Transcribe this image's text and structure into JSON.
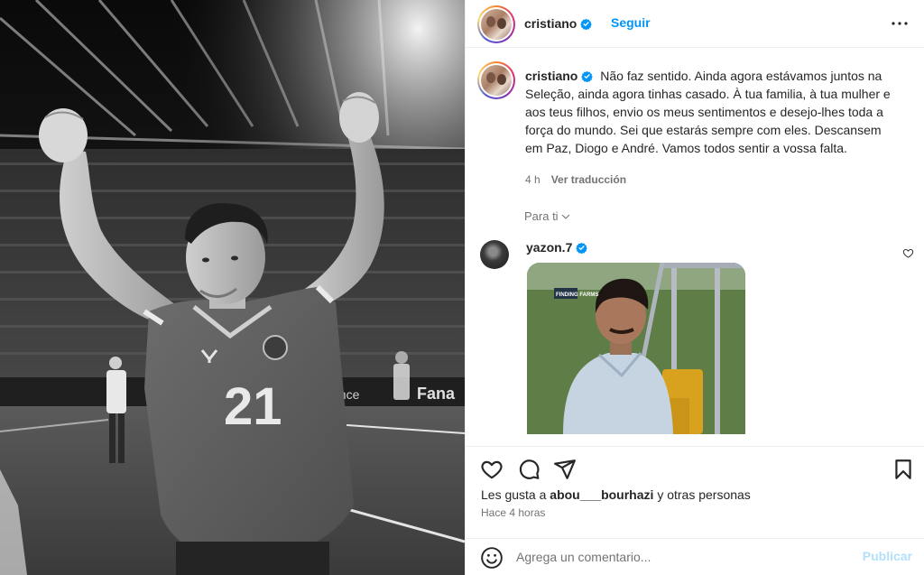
{
  "post": {
    "author": "cristiano",
    "follow_label": "Seguir",
    "caption_author": "cristiano",
    "caption": "Não faz sentido. Ainda agora estávamos juntos na Seleção, ainda agora tinhas casado. À tua familia, à tua mulher e aos teus filhos, envio os meus sentimentos e desejo-lhes toda a força do mundo. Sei que estarás sempre com eles. Descansem em Paz, Diogo e André. Vamos todos sentir a vossa falta.",
    "caption_age": "4 h",
    "translate_label": "Ver traducción",
    "for_you_label": "Para ti",
    "photo": {
      "jersey_number": "21",
      "sponsor_text": "Fana",
      "sponsor_text_left": "ance"
    }
  },
  "comment": {
    "user": "yazon.7",
    "gif_caption": "FINDING FARMS"
  },
  "likes": {
    "prefix": "Les gusta a",
    "user": "abou___bourhazi",
    "suffix": "y otras personas"
  },
  "posted_ago": "Hace 4 horas",
  "composer": {
    "placeholder": "Agrega un comentario...",
    "publish_label": "Publicar"
  },
  "colors": {
    "accent": "#0095f6",
    "verified": "#0095f6",
    "publish_disabled": "#b2dffc",
    "muted": "#737373"
  },
  "icons": [
    "more-options-icon",
    "verified-icon",
    "heart-icon",
    "comment-icon",
    "share-icon",
    "bookmark-icon",
    "emoji-icon",
    "chevron-down-icon"
  ]
}
